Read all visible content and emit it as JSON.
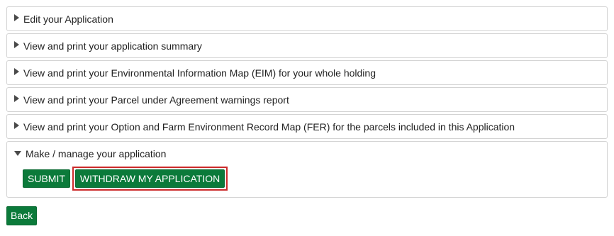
{
  "panels": [
    {
      "label": "Edit your Application",
      "expanded": false
    },
    {
      "label": "View and print your application summary",
      "expanded": false
    },
    {
      "label": "View and print your Environmental Information Map (EIM) for your whole holding",
      "expanded": false
    },
    {
      "label": "View and print your Parcel under Agreement warnings report",
      "expanded": false
    },
    {
      "label": "View and print your Option and Farm Environment Record Map (FER) for the parcels included in this Application",
      "expanded": false
    },
    {
      "label": "Make / manage your application",
      "expanded": true
    }
  ],
  "manage_actions": {
    "submit_label": "SUBMIT",
    "withdraw_label": "WITHDRAW MY APPLICATION"
  },
  "back_label": "Back",
  "icons": {
    "collapsed": "triangle-right-icon",
    "expanded": "triangle-down-icon"
  },
  "colors": {
    "button_green": "#0b7a3a",
    "highlight_red": "#cc2b2b",
    "panel_border": "#d3d3d3"
  }
}
